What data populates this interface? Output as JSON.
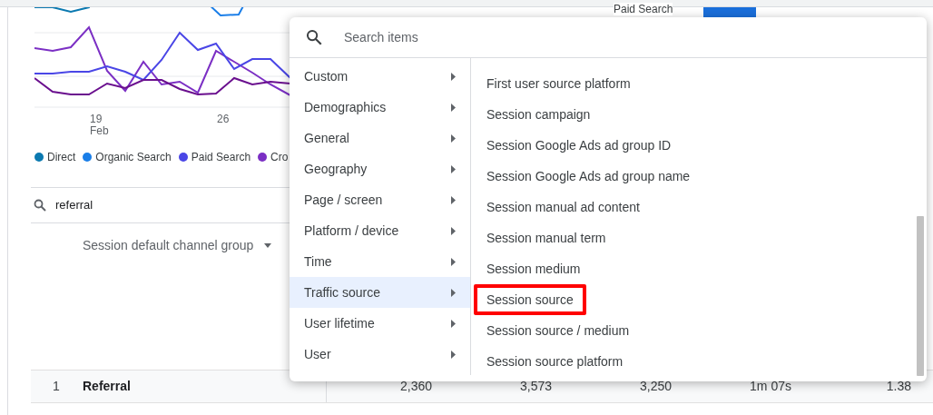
{
  "top_strip": {
    "series_label": "Paid Search"
  },
  "chart": {
    "x_labels": [
      {
        "day": "19",
        "month": "Feb"
      },
      {
        "day": "26"
      }
    ],
    "legend": [
      {
        "label": "Direct",
        "color": "#0b79b0"
      },
      {
        "label": "Organic Search",
        "color": "#1a7ee8"
      },
      {
        "label": "Paid Search",
        "color": "#4a46e6"
      },
      {
        "label": "Cro",
        "color": "#7b2fc4"
      }
    ]
  },
  "table_search": {
    "value": "referral"
  },
  "dimension_header": "Session default channel group",
  "rows": [
    {
      "rank": "1",
      "channel": "Referral",
      "values": [
        "2,360",
        "3,573",
        "3,250",
        "1m 07s",
        "1.38"
      ]
    }
  ],
  "menu": {
    "search_placeholder": "Search items",
    "categories": [
      {
        "label": "Custom",
        "selected": false
      },
      {
        "label": "Demographics",
        "selected": false
      },
      {
        "label": "General",
        "selected": false
      },
      {
        "label": "Geography",
        "selected": false
      },
      {
        "label": "Page / screen",
        "selected": false
      },
      {
        "label": "Platform / device",
        "selected": false
      },
      {
        "label": "Time",
        "selected": false
      },
      {
        "label": "Traffic source",
        "selected": true
      },
      {
        "label": "User lifetime",
        "selected": false
      },
      {
        "label": "User",
        "selected": false
      }
    ],
    "items": [
      {
        "label": "First user source platform",
        "highlighted": false
      },
      {
        "label": "Session campaign",
        "highlighted": false
      },
      {
        "label": "Session Google Ads ad group ID",
        "highlighted": false
      },
      {
        "label": "Session Google Ads ad group name",
        "highlighted": false
      },
      {
        "label": "Session manual ad content",
        "highlighted": false
      },
      {
        "label": "Session manual term",
        "highlighted": false
      },
      {
        "label": "Session medium",
        "highlighted": false
      },
      {
        "label": "Session source",
        "highlighted": true
      },
      {
        "label": "Session source / medium",
        "highlighted": false
      },
      {
        "label": "Session source platform",
        "highlighted": false
      }
    ]
  }
}
